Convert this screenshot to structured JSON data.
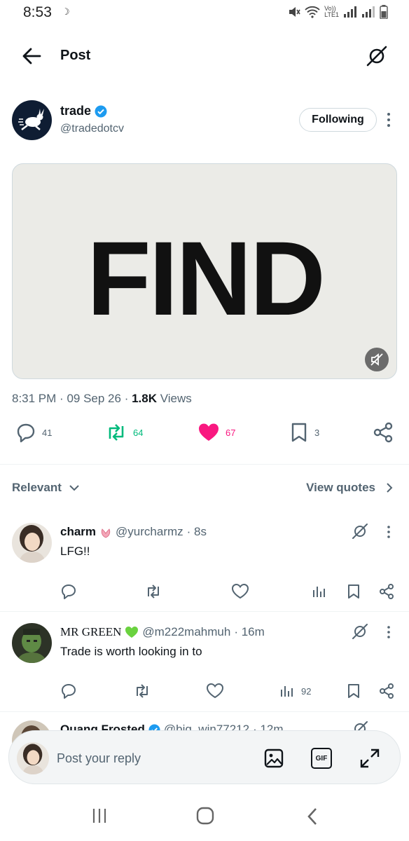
{
  "status_bar": {
    "time": "8:53",
    "network_top": "Vo))",
    "network_bottom": "LTE1"
  },
  "header": {
    "title": "Post"
  },
  "post": {
    "author_name": "trade",
    "author_handle": "@tradedotcv",
    "follow_label": "Following",
    "media_text": "FIND",
    "time": "8:31 PM",
    "date": "09 Sep 26",
    "views_count": "1.8K",
    "views_label": "Views",
    "replies": "41",
    "reposts": "64",
    "likes": "67",
    "bookmarks": "3"
  },
  "sort": {
    "label": "Relevant",
    "quotes_label": "View quotes"
  },
  "replies": [
    {
      "name": "charm",
      "handle": "@yurcharmz",
      "time": "· 8s",
      "text": "LFG!!",
      "views": ""
    },
    {
      "name": "MR GREEN",
      "handle": "@m222mahmuh",
      "time": "· 16m",
      "text": "Trade is worth looking in to",
      "views": "92"
    },
    {
      "name": "Quang Frosted",
      "handle": "@big_win77212",
      "time": "· 12m",
      "text": ""
    }
  ],
  "reply_bar": {
    "placeholder": "Post your reply",
    "gif_label": "GIF"
  },
  "colors": {
    "repost_green": "#00ba7c",
    "like_pink": "#f91880",
    "verified_blue": "#1d9bf0"
  }
}
